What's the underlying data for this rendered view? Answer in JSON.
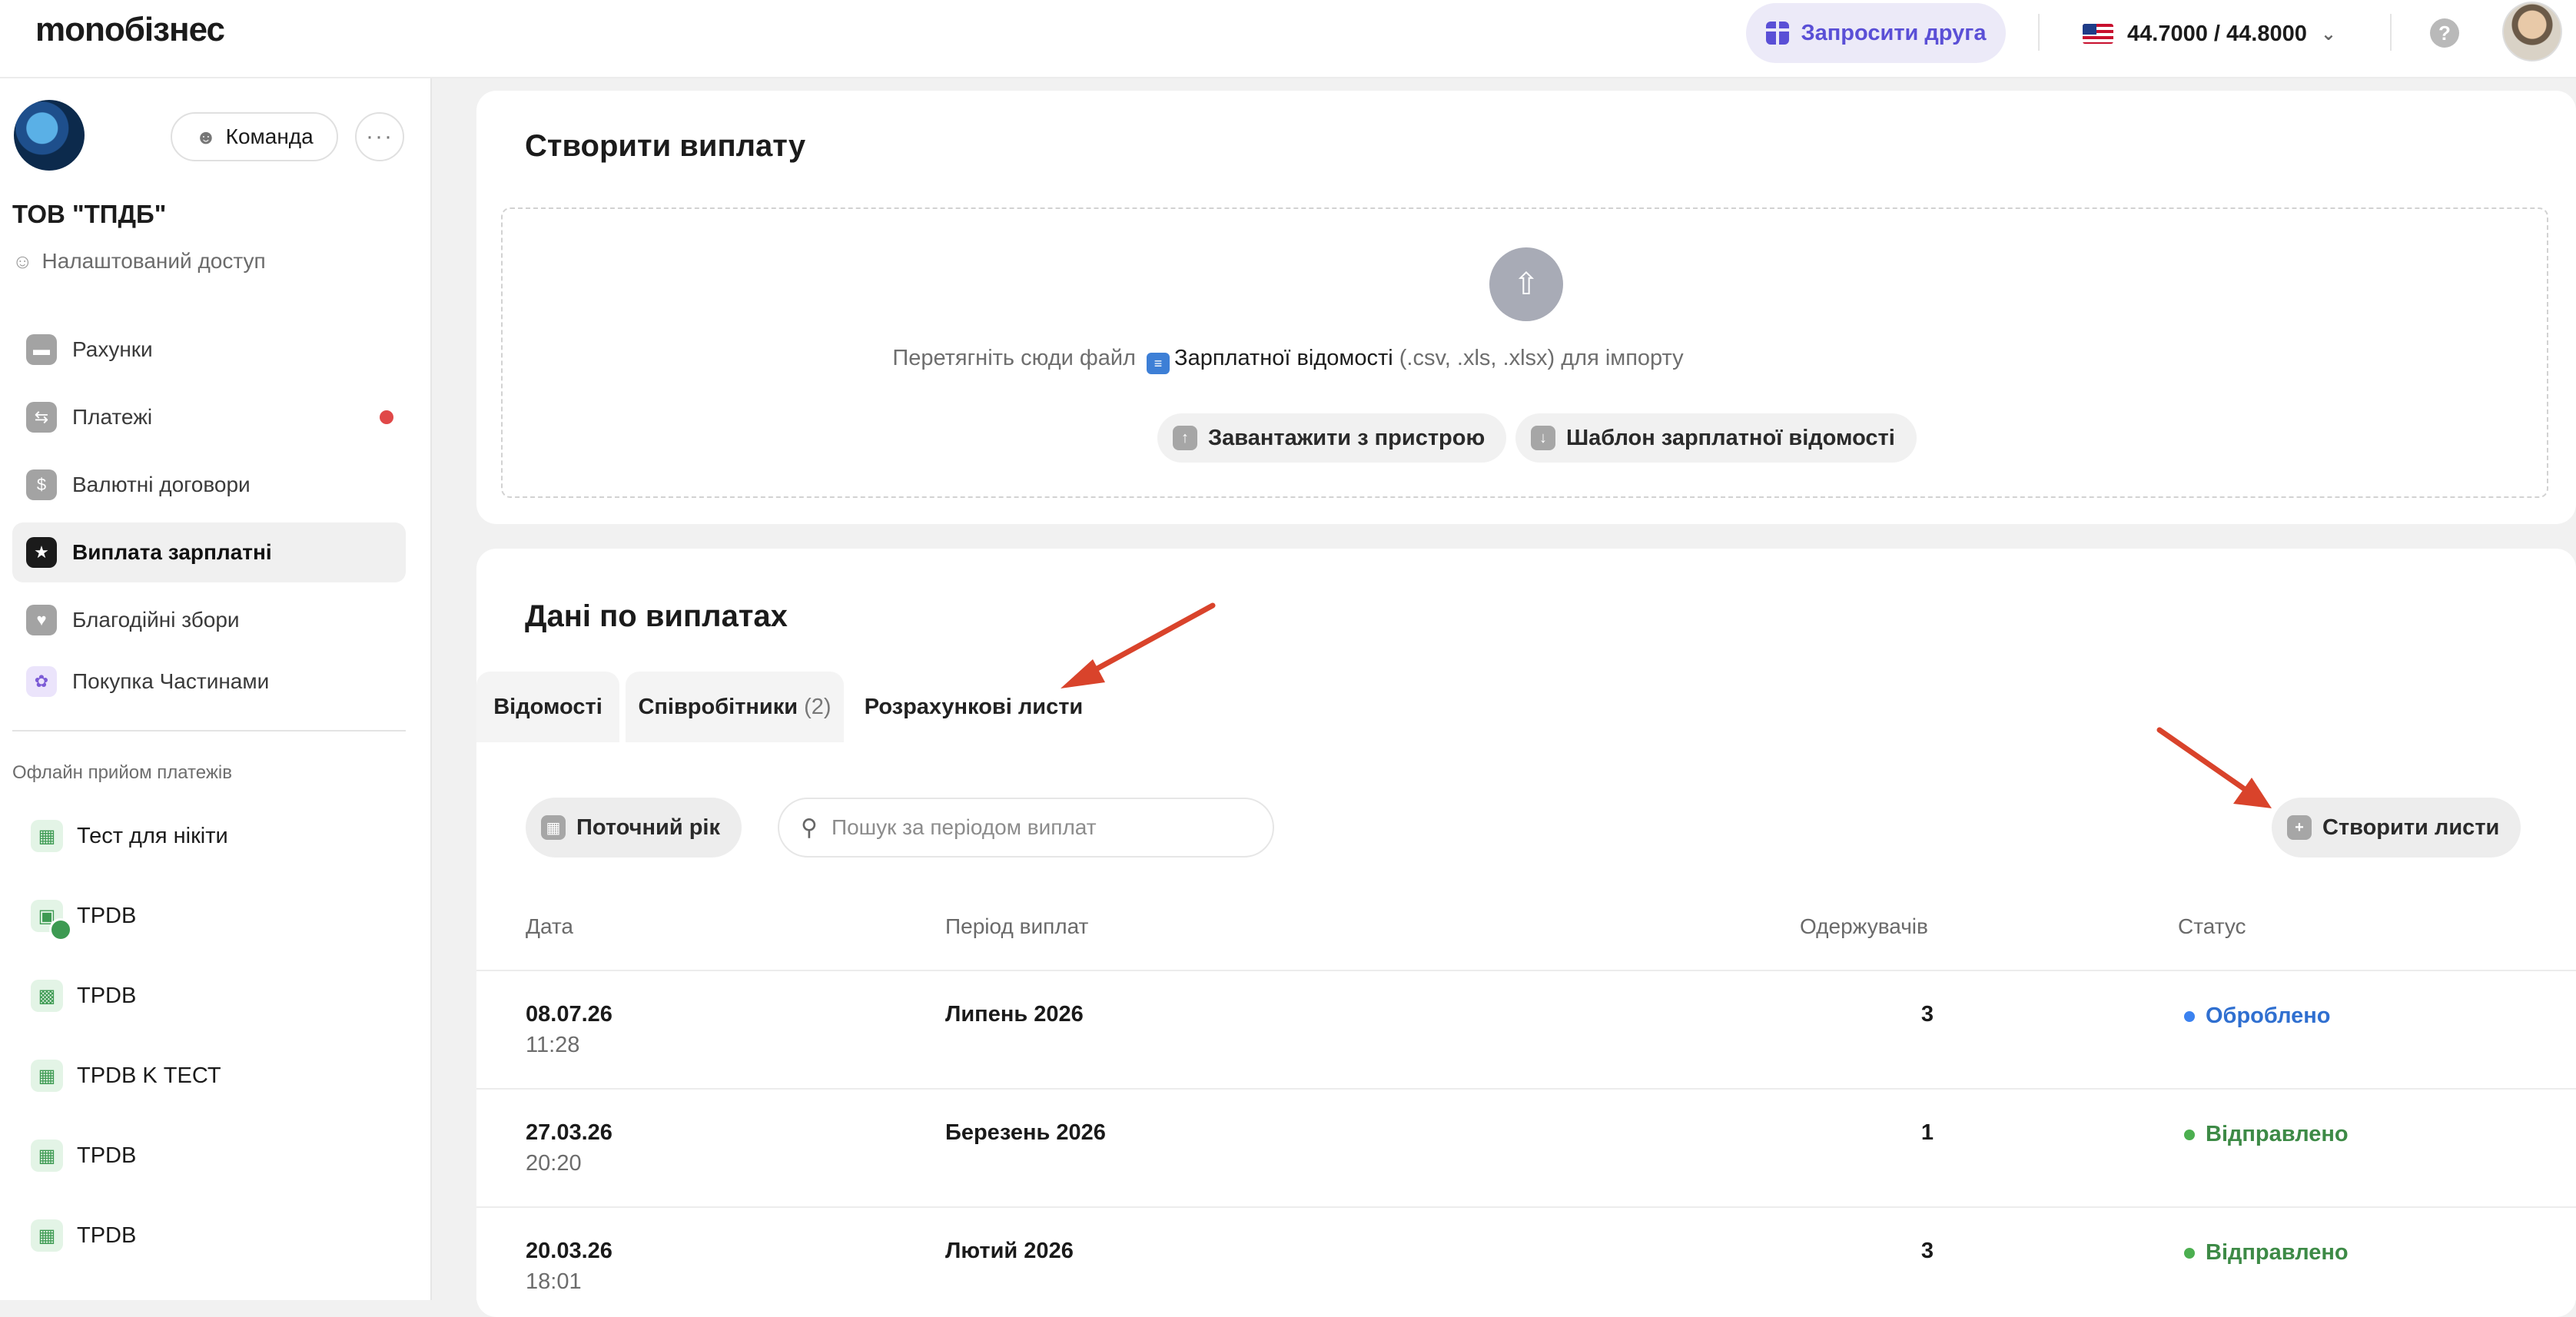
{
  "app": {
    "logo": "monoбізнес",
    "invite_label": "Запросити друга",
    "currency_rate": "44.7000 / 44.8000",
    "help": "?"
  },
  "sidebar": {
    "team_label": "Команда",
    "more_label": "···",
    "org_name": "ТОВ \"ТПДБ\"",
    "access_label": "Налаштований доступ",
    "nav": [
      {
        "label": "Рахунки",
        "icon": "wallet-icon"
      },
      {
        "label": "Платежі",
        "icon": "transfer-icon",
        "badge": "red-dot"
      },
      {
        "label": "Валютні договори",
        "icon": "contract-icon"
      },
      {
        "label": "Виплата зарплатні",
        "icon": "payroll-icon",
        "active": true
      },
      {
        "label": "Благодійні збори",
        "icon": "charity-icon"
      },
      {
        "label": "Покупка Частинами",
        "icon": "paw-icon"
      }
    ],
    "section_title": "Офлайн прийом платежів",
    "pos_items": [
      {
        "label": "Тест для нікіти",
        "icon": "qr-icon"
      },
      {
        "label": "TPDB",
        "icon": "terminal-icon"
      },
      {
        "label": "TPDB",
        "icon": "calculator-icon"
      },
      {
        "label": "TPDB K ТЕСТ",
        "icon": "qr-icon"
      },
      {
        "label": "TPDB",
        "icon": "qr-icon"
      },
      {
        "label": "TPDB",
        "icon": "qr-icon"
      }
    ]
  },
  "create_payout": {
    "title": "Створити виплату",
    "drop_text_before": "Перетягніть сюди файл",
    "drop_text_link": "Зарплатної відомості",
    "drop_text_after": "(.csv, .xls, .xlsx) для імпорту",
    "upload_button": "Завантажити з пристрою",
    "template_button": "Шаблон зарплатної відомості"
  },
  "payouts": {
    "title": "Дані по виплатах",
    "tabs": [
      {
        "label": "Відомості"
      },
      {
        "label": "Співробітники",
        "count": "(2)"
      },
      {
        "label": "Розрахункові листи",
        "active": true
      }
    ],
    "filter_label": "Поточний рік",
    "search_placeholder": "Пошук за періодом виплат",
    "create_button": "Створити листи",
    "columns": {
      "date": "Дата",
      "period": "Період виплат",
      "recipients": "Одержувачів",
      "status": "Статус"
    },
    "rows": [
      {
        "date": "08.07.26",
        "time": "11:28",
        "period": "Липень 2026",
        "recipients": "3",
        "status": "Оброблено",
        "status_color": "#2f6fd0"
      },
      {
        "date": "27.03.26",
        "time": "20:20",
        "period": "Березень 2026",
        "recipients": "1",
        "status": "Відправлено",
        "status_color": "#3d8a46"
      },
      {
        "date": "20.03.26",
        "time": "18:01",
        "period": "Лютий 2026",
        "recipients": "3",
        "status": "Відправлено",
        "status_color": "#3d8a46"
      }
    ]
  },
  "colors": {
    "accent": "#5a4fd6",
    "annotation_arrow": "#d9432b",
    "processed": "#2f6fd0",
    "sent": "#3d8a46"
  }
}
